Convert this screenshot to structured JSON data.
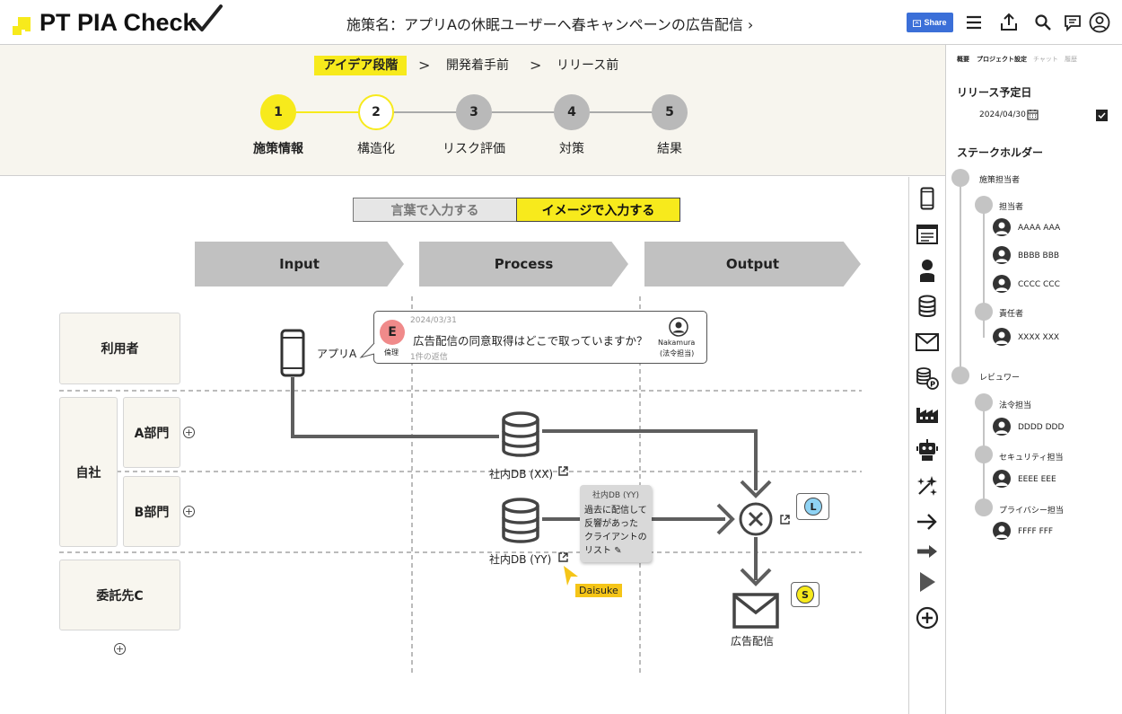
{
  "header": {
    "logo_text": "PT PIA Check",
    "project_title": "施策名：アプリAの休眠ユーザーへ春キャンペーンの広告配信 ›",
    "share_label": "Share"
  },
  "breadcrumb": {
    "items": [
      "アイデア段階",
      "開発着手前",
      "リリース前"
    ],
    "separator": ">"
  },
  "steps": [
    {
      "number": "1",
      "label": "施策情報",
      "state": "done"
    },
    {
      "number": "2",
      "label": "構造化",
      "state": "current"
    },
    {
      "number": "3",
      "label": "リスク評価",
      "state": "todo"
    },
    {
      "number": "4",
      "label": "対策",
      "state": "todo"
    },
    {
      "number": "5",
      "label": "結果",
      "state": "todo"
    }
  ],
  "input_mode": {
    "text_label": "言葉で入力する",
    "image_label": "イメージで入力する",
    "selected": "image"
  },
  "phases": [
    "Input",
    "Process",
    "Output"
  ],
  "actors": {
    "user": "利用者",
    "company": "自社",
    "dept_a": "A部門",
    "dept_b": "B部門",
    "contractor": "委託先C"
  },
  "nodes": {
    "app": "アプリA",
    "db_xx": "社内DB (XX)",
    "db_yy": "社内DB (YY)",
    "output": "広告配信"
  },
  "comment": {
    "badge_letter": "E",
    "badge_role": "倫理",
    "date": "2024/03/31",
    "text": "広告配信の同意取得はどこで取っていますか？",
    "replies": "1件の返信",
    "author": "Nakamura",
    "author_role": "(法令担当)"
  },
  "tooltip": {
    "title": "社内DB (YY)",
    "lines": [
      "過去に配信して",
      "反響があった",
      "クライアントの",
      "リスト"
    ]
  },
  "cursor_user": "Daisuke",
  "badges": {
    "merge": "L",
    "mail": "S"
  },
  "right_panel": {
    "tabs": [
      "概要",
      "プロジェクト設定",
      "チャット",
      "履歴"
    ],
    "release_heading": "リリース予定日",
    "release_date": "2024/04/30",
    "stakeholder_heading": "ステークホルダー",
    "owner_group": "施策担当者",
    "owner_sub": "担当者",
    "owner_members": [
      "AAAA AAA",
      "BBBB BBB",
      "CCCC CCC"
    ],
    "responsible_sub": "責任者",
    "responsible_members": [
      "XXXX XXX"
    ],
    "reviewer_group": "レビュワー",
    "legal_sub": "法令担当",
    "legal_members": [
      "DDDD DDD"
    ],
    "security_sub": "セキュリティ担当",
    "security_members": [
      "EEEE EEE"
    ],
    "privacy_sub": "プライバシー担当",
    "privacy_members": [
      "FFFF FFF"
    ]
  },
  "colors": {
    "accent_yellow": "#f7ea1c",
    "share_blue": "#3b6fd8",
    "badge_red": "#f08a8a",
    "badge_blue": "#8fd3f4",
    "cursor_yellow": "#f5c518"
  }
}
